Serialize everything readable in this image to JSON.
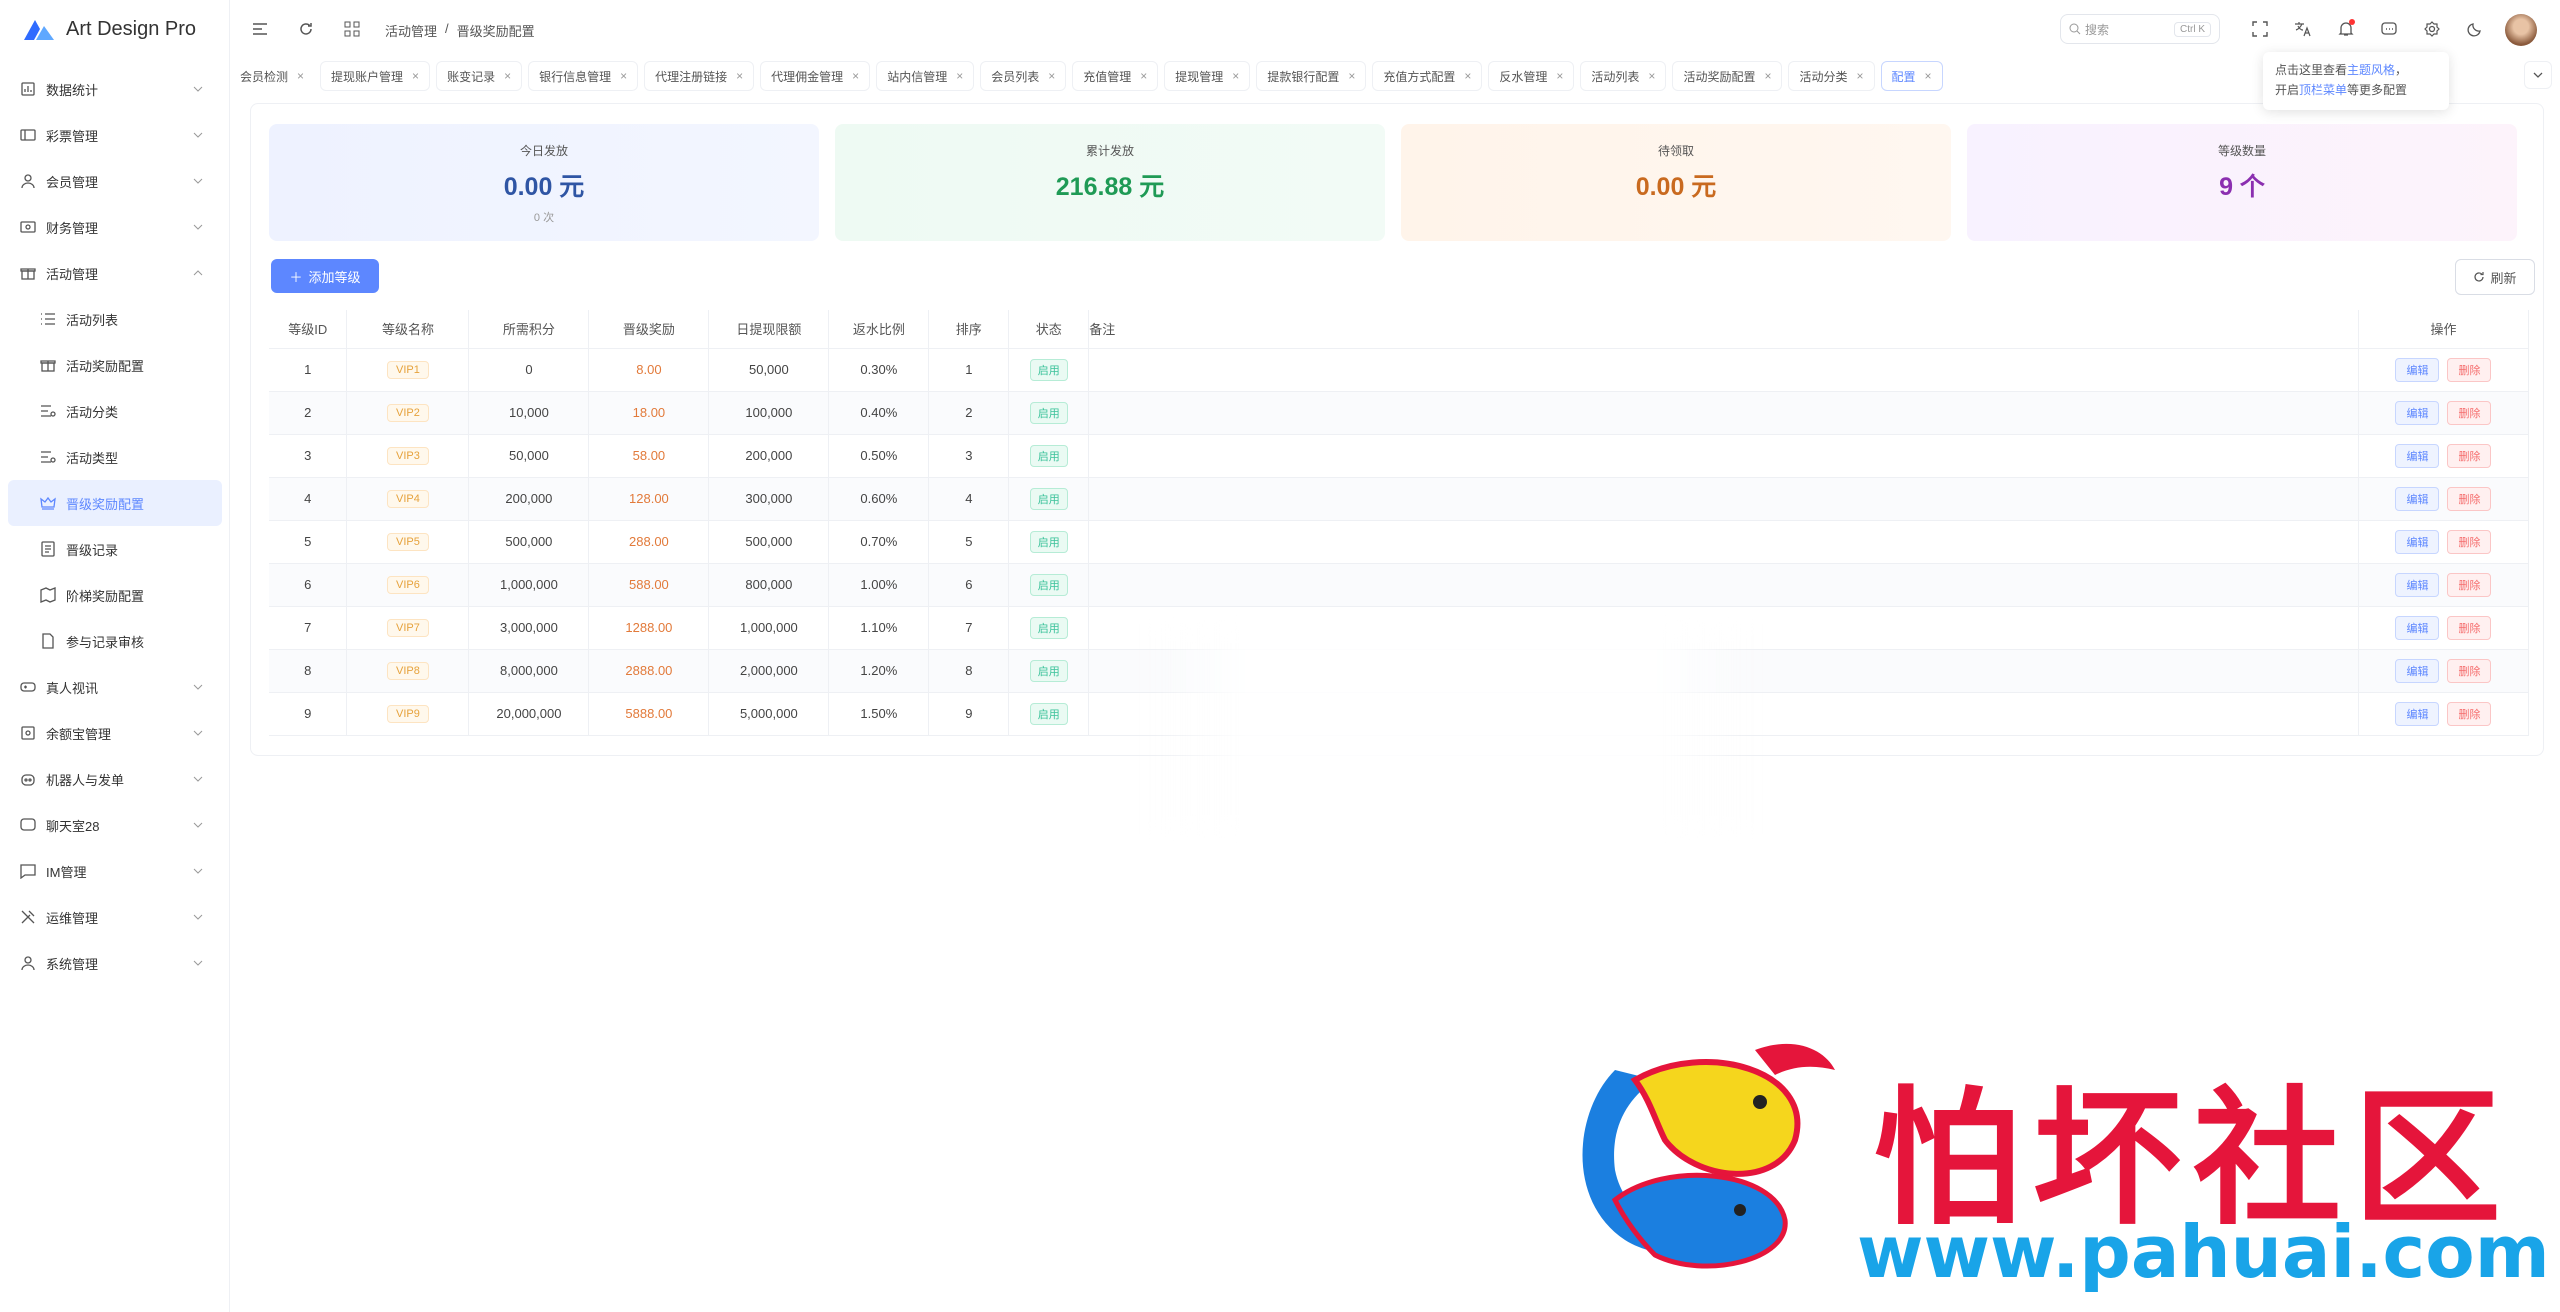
{
  "app": {
    "name": "Art Design Pro"
  },
  "sidebar": {
    "items": [
      {
        "label": "数据统计",
        "icon": "chart-icon",
        "expandable": true
      },
      {
        "label": "彩票管理",
        "icon": "ticket-icon",
        "expandable": true
      },
      {
        "label": "会员管理",
        "icon": "user-icon",
        "expandable": true
      },
      {
        "label": "财务管理",
        "icon": "wallet-icon",
        "expandable": true
      },
      {
        "label": "活动管理",
        "icon": "gift-icon",
        "expandable": true,
        "expanded": true
      },
      {
        "label": "活动列表",
        "icon": "list-icon",
        "sub": true
      },
      {
        "label": "活动奖励配置",
        "icon": "gift-icon",
        "sub": true
      },
      {
        "label": "活动分类",
        "icon": "filter-icon",
        "sub": true
      },
      {
        "label": "活动类型",
        "icon": "filter-icon",
        "sub": true
      },
      {
        "label": "晋级奖励配置",
        "icon": "crown-icon",
        "sub": true,
        "active": true
      },
      {
        "label": "晋级记录",
        "icon": "doc-icon",
        "sub": true
      },
      {
        "label": "阶梯奖励配置",
        "icon": "map-icon",
        "sub": true
      },
      {
        "label": "参与记录审核",
        "icon": "file-icon",
        "sub": true
      },
      {
        "label": "真人视讯",
        "icon": "gamepad-icon",
        "expandable": true
      },
      {
        "label": "余额宝管理",
        "icon": "safe-icon",
        "expandable": true
      },
      {
        "label": "机器人与发单",
        "icon": "robot-icon",
        "expandable": true
      },
      {
        "label": "聊天室28",
        "icon": "chat-icon",
        "expandable": true
      },
      {
        "label": "IM管理",
        "icon": "message-icon",
        "expandable": true
      },
      {
        "label": "运维管理",
        "icon": "tools-icon",
        "expandable": true
      },
      {
        "label": "系统管理",
        "icon": "user-icon",
        "expandable": true
      }
    ]
  },
  "header": {
    "breadcrumb": [
      "活动管理",
      "晋级奖励配置"
    ],
    "breadcrumb_sep": "/",
    "search_placeholder": "搜索",
    "search_kbd": "Ctrl K"
  },
  "tabs": [
    {
      "label": "会员检测"
    },
    {
      "label": "提现账户管理"
    },
    {
      "label": "账变记录"
    },
    {
      "label": "银行信息管理"
    },
    {
      "label": "代理注册链接"
    },
    {
      "label": "代理佣金管理"
    },
    {
      "label": "站内信管理"
    },
    {
      "label": "会员列表"
    },
    {
      "label": "充值管理"
    },
    {
      "label": "提现管理"
    },
    {
      "label": "提款银行配置"
    },
    {
      "label": "充值方式配置"
    },
    {
      "label": "反水管理"
    },
    {
      "label": "活动列表"
    },
    {
      "label": "活动奖励配置"
    },
    {
      "label": "活动分类"
    },
    {
      "label": "配置",
      "active": true
    }
  ],
  "tooltip": {
    "pre": "点击这里查看",
    "link": "主题风格",
    "post": "，",
    "line2_pre": "开启",
    "line2_link": "顶栏菜单",
    "line2_post": "等更多配置"
  },
  "stats": [
    {
      "label": "今日发放",
      "value": "0.00 元",
      "sub": "0 次",
      "color": "#2f55a4",
      "bg": "linear-gradient(90deg,#eef2ff,#f3f6ff)"
    },
    {
      "label": "累计发放",
      "value": "216.88 元",
      "sub": "",
      "color": "#1f9a55",
      "bg": "linear-gradient(90deg,#eefaf3,#f2fbf6)"
    },
    {
      "label": "待领取",
      "value": "0.00 元",
      "sub": "",
      "color": "#c96a1f",
      "bg": "linear-gradient(90deg,#fff4ea,#fff7f0)"
    },
    {
      "label": "等级数量",
      "value": "9 个",
      "sub": "",
      "color": "#8b2fb0",
      "bg": "linear-gradient(90deg,#f8f2ff,#fdf3fb)"
    }
  ],
  "actions": {
    "add": "添加等级",
    "refresh": "刷新"
  },
  "table": {
    "headers": [
      "等级ID",
      "等级名称",
      "所需积分",
      "晋级奖励",
      "日提现限额",
      "返水比例",
      "排序",
      "状态",
      "备注",
      "操作"
    ],
    "rows": [
      {
        "id": "1",
        "name": "VIP1",
        "points": "0",
        "bonus": "8.00",
        "limit": "50,000",
        "rebate": "0.30%",
        "sort": "1",
        "status": "启用"
      },
      {
        "id": "2",
        "name": "VIP2",
        "points": "10,000",
        "bonus": "18.00",
        "limit": "100,000",
        "rebate": "0.40%",
        "sort": "2",
        "status": "启用"
      },
      {
        "id": "3",
        "name": "VIP3",
        "points": "50,000",
        "bonus": "58.00",
        "limit": "200,000",
        "rebate": "0.50%",
        "sort": "3",
        "status": "启用"
      },
      {
        "id": "4",
        "name": "VIP4",
        "points": "200,000",
        "bonus": "128.00",
        "limit": "300,000",
        "rebate": "0.60%",
        "sort": "4",
        "status": "启用"
      },
      {
        "id": "5",
        "name": "VIP5",
        "points": "500,000",
        "bonus": "288.00",
        "limit": "500,000",
        "rebate": "0.70%",
        "sort": "5",
        "status": "启用"
      },
      {
        "id": "6",
        "name": "VIP6",
        "points": "1,000,000",
        "bonus": "588.00",
        "limit": "800,000",
        "rebate": "1.00%",
        "sort": "6",
        "status": "启用"
      },
      {
        "id": "7",
        "name": "VIP7",
        "points": "3,000,000",
        "bonus": "1288.00",
        "limit": "1,000,000",
        "rebate": "1.10%",
        "sort": "7",
        "status": "启用"
      },
      {
        "id": "8",
        "name": "VIP8",
        "points": "8,000,000",
        "bonus": "2888.00",
        "limit": "2,000,000",
        "rebate": "1.20%",
        "sort": "8",
        "status": "启用"
      },
      {
        "id": "9",
        "name": "VIP9",
        "points": "20,000,000",
        "bonus": "5888.00",
        "limit": "5,000,000",
        "rebate": "1.50%",
        "sort": "9",
        "status": "启用"
      }
    ],
    "edit_label": "编辑",
    "delete_label": "删除"
  },
  "watermark": {
    "title": "怕坏社区",
    "url": "www.pahuai.com"
  }
}
